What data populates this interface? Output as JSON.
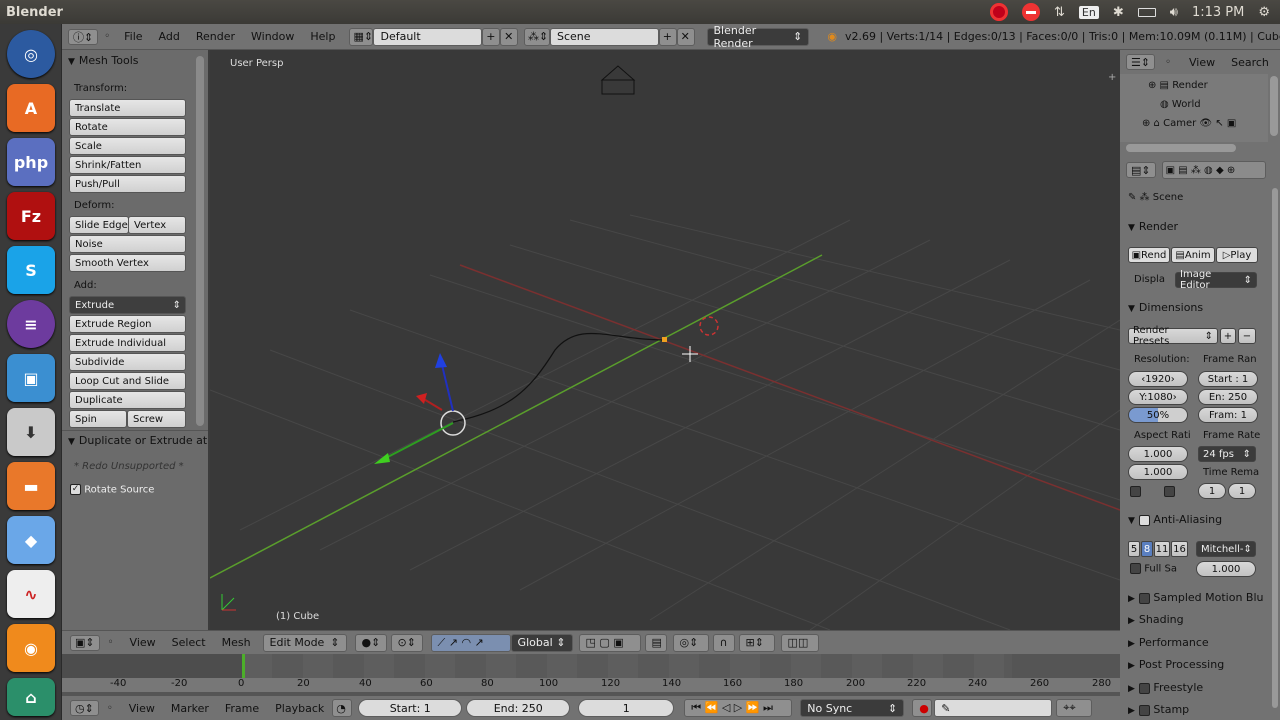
{
  "os": {
    "title": "Blender",
    "lang": "En",
    "time": "1:13 PM"
  },
  "info_header": {
    "menus": [
      "File",
      "Add",
      "Render",
      "Window",
      "Help"
    ],
    "layout": "Default",
    "scene": "Scene",
    "engine": "Blender Render",
    "stats": "v2.69 | Verts:1/14 | Edges:0/13 | Faces:0/0 | Tris:0 | Mem:10.09M (0.11M) | Cube"
  },
  "tools": {
    "panel_title": "Mesh Tools",
    "transform_label": "Transform:",
    "translate": "Translate",
    "rotate": "Rotate",
    "scale": "Scale",
    "shrink": "Shrink/Fatten",
    "push": "Push/Pull",
    "deform_label": "Deform:",
    "slide_edge": "Slide Edge",
    "vertex": "Vertex",
    "noise": "Noise",
    "smooth_vertex": "Smooth Vertex",
    "add_label": "Add:",
    "extrude": "Extrude",
    "extrude_region": "Extrude Region",
    "extrude_individual": "Extrude Individual",
    "subdivide": "Subdivide",
    "loop_cut": "Loop Cut and Slide",
    "duplicate": "Duplicate",
    "spin": "Spin",
    "screw": "Screw",
    "op_title": "Duplicate or Extrude at",
    "redo": "* Redo Unsupported *",
    "rotate_source": "Rotate Source"
  },
  "viewport": {
    "label": "User Persp",
    "object": "(1) Cube"
  },
  "v3d_header": {
    "menus": [
      "View",
      "Select",
      "Mesh"
    ],
    "mode": "Edit Mode",
    "orientation": "Global"
  },
  "timeline": {
    "ticks": [
      "-40",
      "-20",
      "0",
      "20",
      "40",
      "60",
      "80",
      "100",
      "120",
      "140",
      "160",
      "180",
      "200",
      "220",
      "240",
      "260",
      "280"
    ]
  },
  "tl_header": {
    "menus": [
      "View",
      "Marker",
      "Frame",
      "Playback"
    ],
    "start": "Start: 1",
    "end": "End: 250",
    "current": "1",
    "sync": "No Sync"
  },
  "outliner": {
    "view": "View",
    "search": "Search",
    "items": [
      "Render",
      "World",
      "Camer"
    ]
  },
  "props": {
    "scene": "Scene",
    "render": "Render",
    "render_btn": "Rend",
    "anim_btn": "Anim",
    "play_btn": "Play",
    "display_label": "Displa",
    "display_value": "Image Editor",
    "dimensions": "Dimensions",
    "presets": "Render Presets",
    "resolution": "Resolution:",
    "frame_range": "Frame Ran",
    "res_x": "1920",
    "res_y": "1080",
    "res_pct": "50%",
    "start": "Start : 1",
    "end": "En: 250",
    "frame_step": "Fram: 1",
    "aspect": "Aspect Rati",
    "frame_rate": "Frame Rate",
    "asp_x": "1.000",
    "asp_y": "1.000",
    "fps": "24 fps",
    "time_remap": "Time Rema",
    "remap_old": "1",
    "remap_new": "1",
    "aa": "Anti-Aliasing",
    "aa_5": "5",
    "aa_8": "8",
    "aa_11": "11",
    "aa_16": "16",
    "aa_filter": "Mitchell-",
    "full_sample": "Full Sa",
    "filter_size": "1.000",
    "sampled_motion": "Sampled Motion Blu",
    "shading": "Shading",
    "performance": "Performance",
    "post_processing": "Post Processing",
    "freestyle": "Freestyle",
    "stamp": "Stamp"
  }
}
